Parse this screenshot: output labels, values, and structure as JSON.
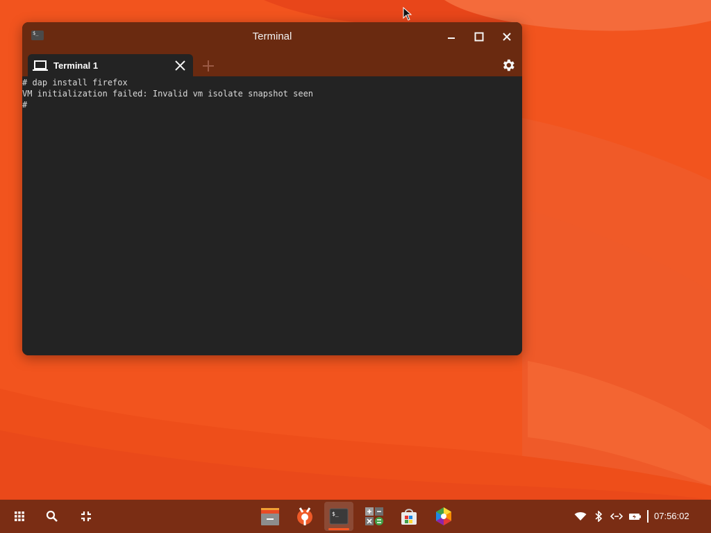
{
  "window": {
    "title": "Terminal",
    "app_icon_glyph": "$_",
    "controls": [
      "minimize-icon",
      "maximize-icon",
      "close-icon"
    ]
  },
  "tabs": [
    {
      "label": "Terminal 1",
      "icon": "laptop-icon",
      "active": true
    }
  ],
  "new_tab_icon": "plus-icon",
  "settings_icon": "gear-icon",
  "terminal": {
    "lines": [
      "# dap install firefox",
      "VM initialization failed: Invalid vm isolate snapshot seen",
      "#"
    ]
  },
  "shelf": {
    "left_buttons": [
      "launcher-icon",
      "search-icon",
      "overview-icon"
    ],
    "apps": [
      {
        "name": "files-app",
        "icon": "files-icon",
        "active": false
      },
      {
        "name": "settings-app",
        "icon": "wrench-gear-icon",
        "active": false
      },
      {
        "name": "terminal-app",
        "icon": "terminal-icon",
        "glyph": "$_",
        "active": true
      },
      {
        "name": "calculator-app",
        "icon": "calculator-icon",
        "active": false
      },
      {
        "name": "store-app",
        "icon": "store-bag-icon",
        "active": false
      },
      {
        "name": "browser-app",
        "icon": "hexagon-browser-icon",
        "active": false
      }
    ],
    "tray": {
      "icons": [
        "wifi-icon",
        "bluetooth-icon",
        "vpn-icon",
        "battery-icon"
      ],
      "clock": "07:56:02"
    }
  },
  "colors": {
    "accent": "#ff5722",
    "titlebar": "#6a2a10",
    "terminal_bg": "#232323",
    "shelf": "#7a2d14"
  }
}
